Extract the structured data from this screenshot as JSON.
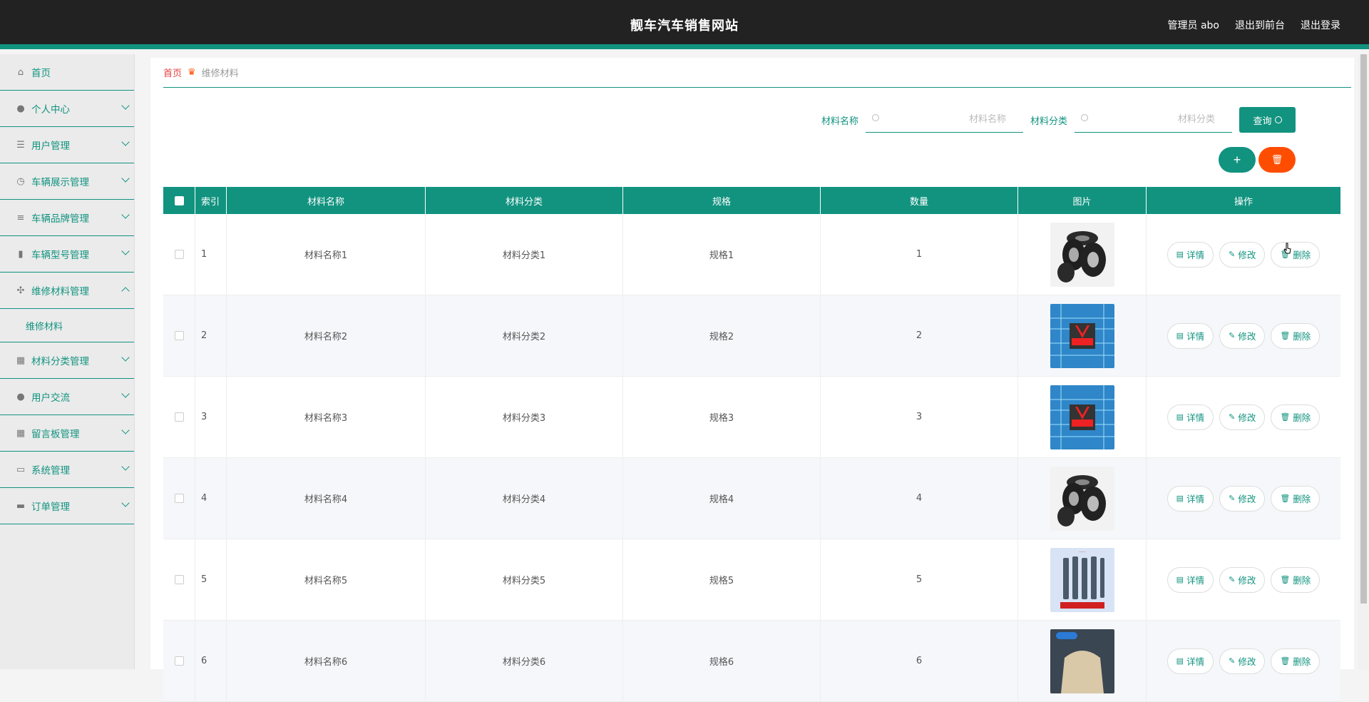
{
  "header": {
    "title": "靓车汽车销售网站",
    "user": "管理员 abo",
    "to_front": "退出到前台",
    "logout": "退出登录"
  },
  "sidebar": {
    "items": [
      {
        "label": "首页",
        "icon": "home-icon"
      },
      {
        "label": "个人中心",
        "icon": "user-icon"
      },
      {
        "label": "用户管理",
        "icon": "list-icon"
      },
      {
        "label": "车辆展示管理",
        "icon": "clock-icon"
      },
      {
        "label": "车辆品牌管理",
        "icon": "sliders-icon"
      },
      {
        "label": "车辆型号管理",
        "icon": "mic-icon"
      },
      {
        "label": "维修材料管理",
        "icon": "dashboard-icon",
        "expanded": true,
        "children": [
          "维修材料"
        ]
      },
      {
        "label": "材料分类管理",
        "icon": "grid-icon"
      },
      {
        "label": "用户交流",
        "icon": "user-icon"
      },
      {
        "label": "留言板管理",
        "icon": "grid-icon"
      },
      {
        "label": "系统管理",
        "icon": "message-icon"
      },
      {
        "label": "订单管理",
        "icon": "chat-icon"
      }
    ]
  },
  "breadcrumb": {
    "home": "首页",
    "current": "维修材料"
  },
  "search": {
    "name_label": "材料名称",
    "name_placeholder": "材料名称",
    "category_label": "材料分类",
    "category_placeholder": "材料分类",
    "query_label": "查询"
  },
  "actions": {
    "add": "+",
    "delete": "🗑"
  },
  "table": {
    "columns": [
      "索引",
      "材料名称",
      "材料分类",
      "规格",
      "数量",
      "图片",
      "操作"
    ],
    "rows": [
      {
        "index": "1",
        "name": "材料名称1",
        "category": "材料分类1",
        "spec": "规格1",
        "qty": "1",
        "image": "tires"
      },
      {
        "index": "2",
        "name": "材料名称2",
        "category": "材料分类2",
        "spec": "规格2",
        "qty": "2",
        "image": "chip"
      },
      {
        "index": "3",
        "name": "材料名称3",
        "category": "材料分类3",
        "spec": "规格3",
        "qty": "3",
        "image": "chip"
      },
      {
        "index": "4",
        "name": "材料名称4",
        "category": "材料分类4",
        "spec": "规格4",
        "qty": "4",
        "image": "tires"
      },
      {
        "index": "5",
        "name": "材料名称5",
        "category": "材料分类5",
        "spec": "规格5",
        "qty": "5",
        "image": "plugs"
      },
      {
        "index": "6",
        "name": "材料名称6",
        "category": "材料分类6",
        "spec": "规格6",
        "qty": "6",
        "image": "seat"
      }
    ],
    "ops": {
      "detail": "详情",
      "edit": "修改",
      "delete": "删除"
    }
  },
  "colors": {
    "accent": "#11937f",
    "danger": "#ff4d00",
    "header": "#222222"
  }
}
